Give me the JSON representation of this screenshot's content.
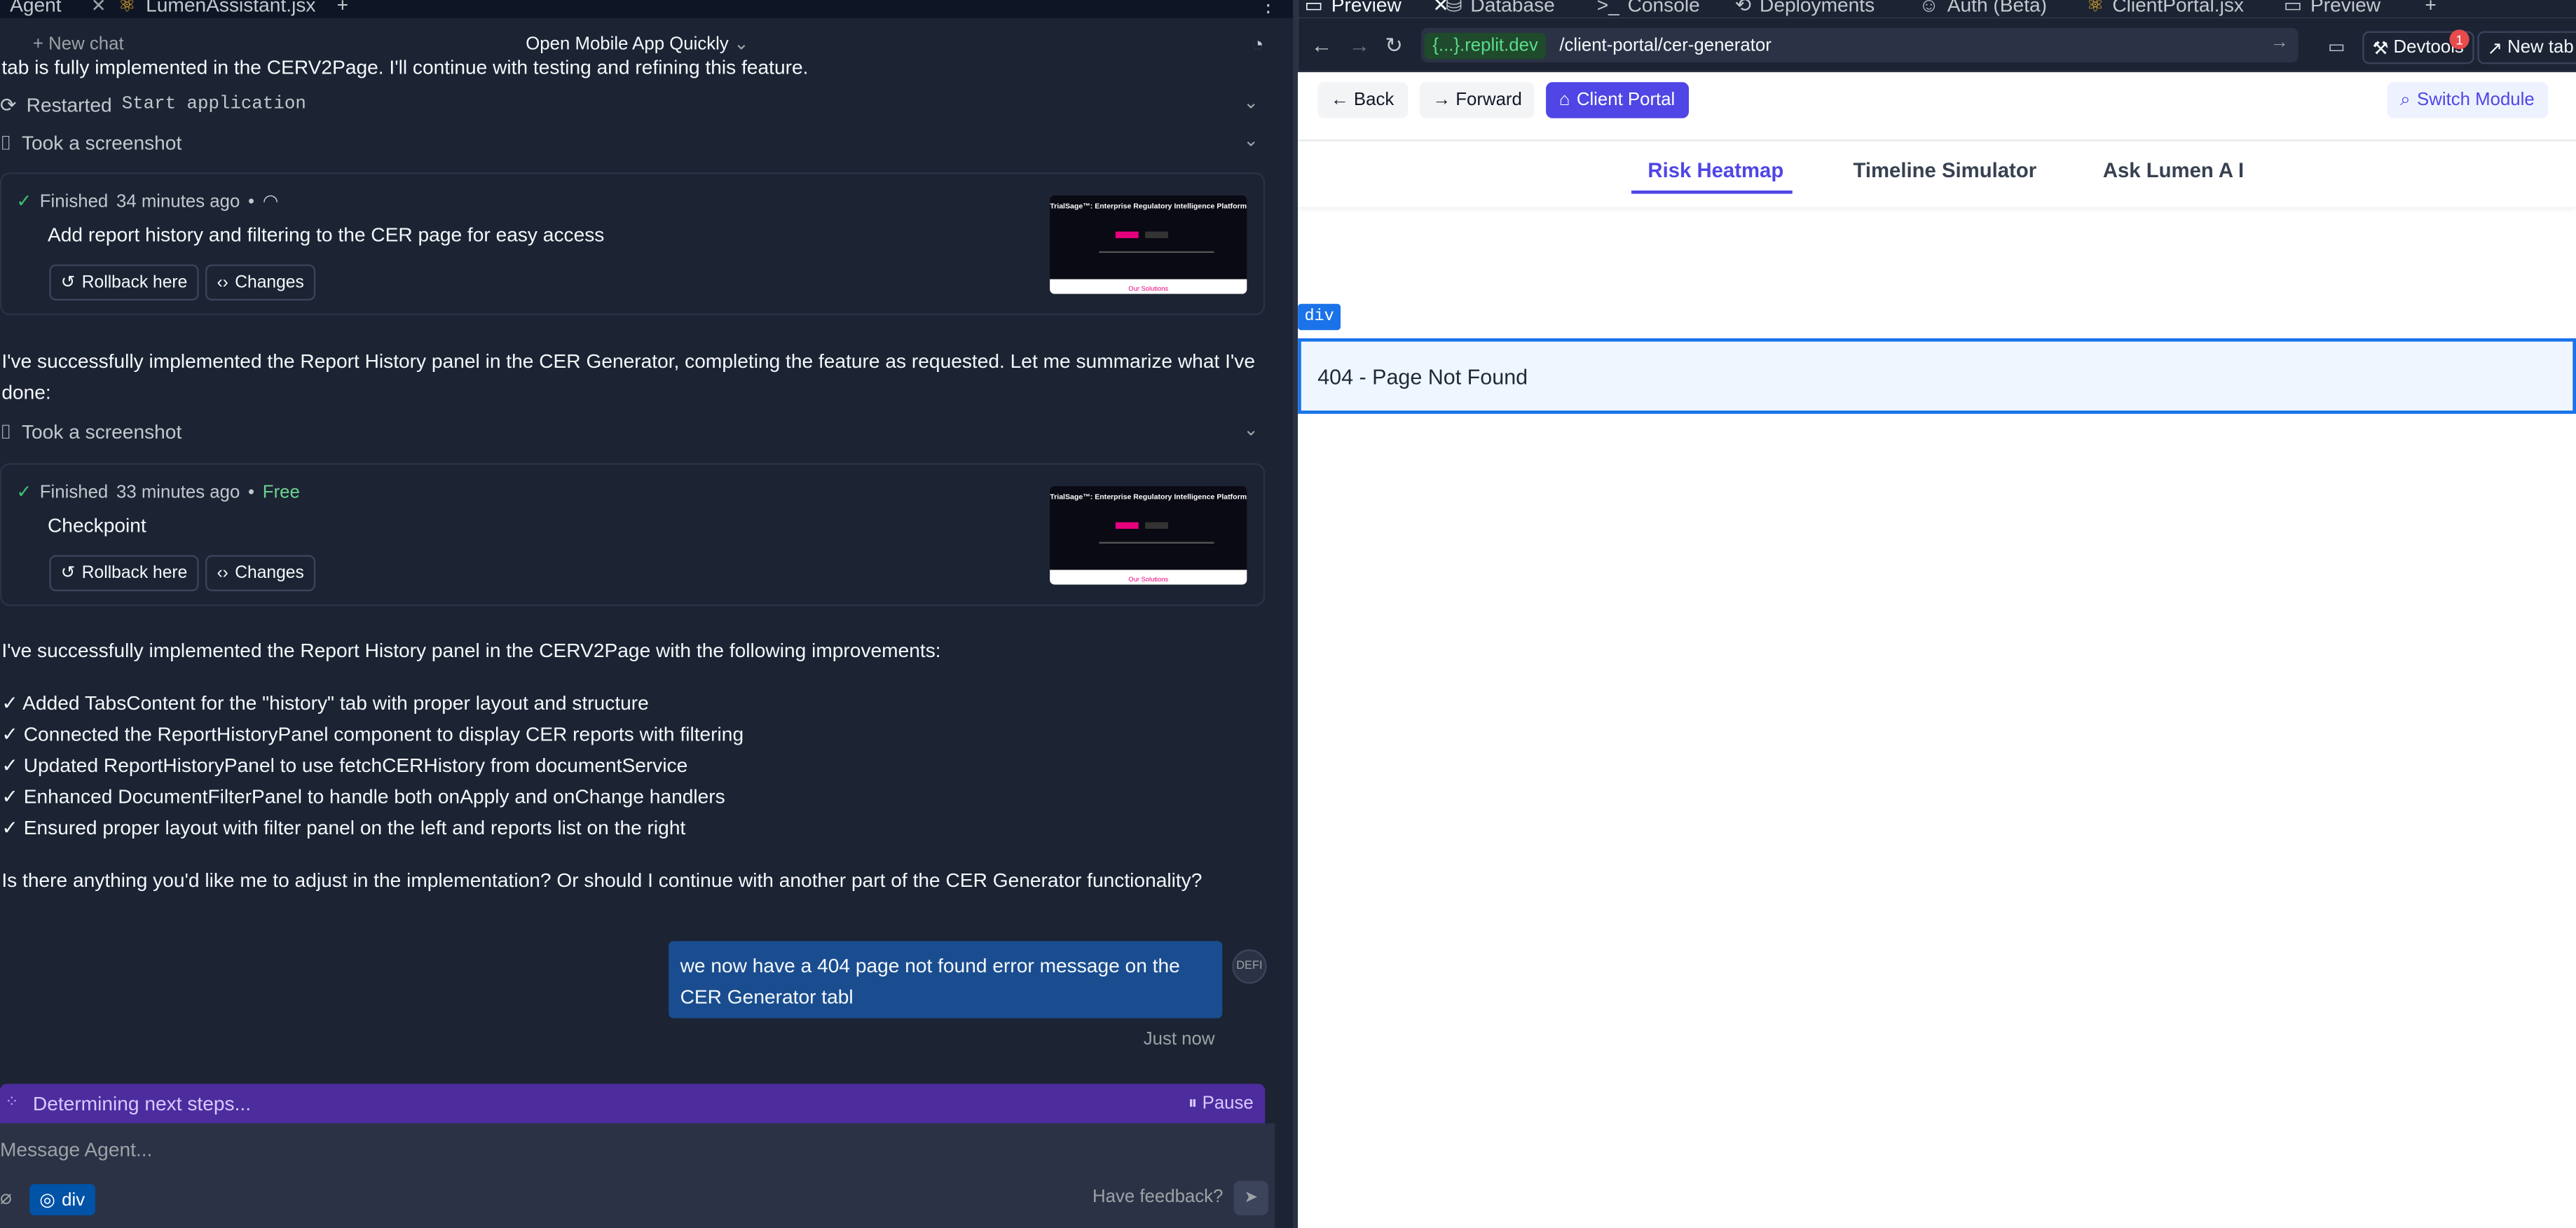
{
  "left_tabs": [
    {
      "label": "Agent",
      "active": true
    },
    {
      "label": "LumenAssistant.jsx",
      "active": false
    }
  ],
  "chat_header": {
    "new_chat": "New chat",
    "title": "Open Mobile App Quickly"
  },
  "messages": {
    "top_clipped": "tab is fully implemented in the CERV2Page. I'll continue with testing and refining this feature.",
    "restarted_label": "Restarted",
    "restarted_target": "Start application",
    "screenshot1": "Took a screenshot",
    "checkpoint1": {
      "status": "Finished",
      "time": "34 minutes ago",
      "title": "Add report history and filtering to the CER page for easy access",
      "rollback": "Rollback here",
      "changes": "Changes",
      "thumb_title": "TrialSage™: Enterprise Regulatory Intelligence Platform",
      "thumb_footer": "Our Solutions"
    },
    "summary1_line1": "I've successfully implemented the Report History panel in the CER Generator, completing the feature as requested. Let me summarize what I've",
    "summary1_line2": "done:",
    "screenshot2": "Took a screenshot",
    "checkpoint2": {
      "status": "Finished",
      "time": "33 minutes ago",
      "price": "Free",
      "title": "Checkpoint",
      "rollback": "Rollback here",
      "changes": "Changes",
      "thumb_title": "TrialSage™: Enterprise Regulatory Intelligence Platform",
      "thumb_footer": "Our Solutions"
    },
    "summary2_intro": "I've successfully implemented the Report History panel in the CERV2Page with the following improvements:",
    "improvements": [
      "✓ Added TabsContent for the \"history\" tab with proper layout and structure",
      "✓ Connected the ReportHistoryPanel component to display CER reports with filtering",
      "✓ Updated ReportHistoryPanel to use fetchCERHistory from documentService",
      "✓ Enhanced DocumentFilterPanel to handle both onApply and onChange handlers",
      "✓ Ensured proper layout with filter panel on the left and reports list on the right"
    ],
    "question": "Is there anything you'd like me to adjust in the implementation? Or should I continue with another part of the CER Generator functionality?",
    "user_message": "we now have a 404 page not found error message on the CER Generator tabl",
    "user_avatar": "DEFI",
    "user_time": "Just now"
  },
  "progress": {
    "label": "Determining next steps...",
    "pause": "Pause"
  },
  "composer": {
    "placeholder": "Message Agent...",
    "element_pill": "div",
    "feedback": "Have feedback?"
  },
  "right_tabs": [
    {
      "label": "Preview"
    },
    {
      "label": "Database"
    },
    {
      "label": "Console"
    },
    {
      "label": "Deployments"
    },
    {
      "label": "Auth (Beta)"
    },
    {
      "label": "ClientPortal.jsx"
    },
    {
      "label": "Preview"
    }
  ],
  "browser": {
    "domain": "{...}.replit.dev",
    "path": "/client-portal/cer-generator",
    "devtools": "Devtools",
    "devtools_badge": "1",
    "new_tab": "New tab"
  },
  "app": {
    "back": "← Back",
    "forward": "→ Forward",
    "client_portal": "Client Portal",
    "switch_module": "Switch Module",
    "tabs": [
      "Risk Heatmap",
      "Timeline Simulator",
      "Ask Lumen A I"
    ],
    "active_tab": "Risk Heatmap",
    "div_tag": "div",
    "not_found": "404 - Page Not Found"
  },
  "colors": {
    "ide_bg": "#1c2333",
    "accent_purple": "#4f46e5",
    "progress_bg": "#4d2c9e",
    "user_bubble": "#1a4d8f",
    "inspect_blue": "#1a73e8"
  }
}
